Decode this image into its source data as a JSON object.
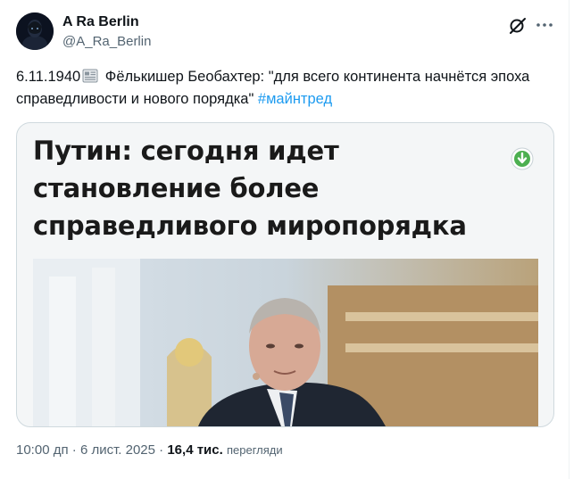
{
  "author": {
    "name": "A Ra Berlin",
    "handle": "@A_Ra_Berlin"
  },
  "tweet": {
    "date_prefix": "6.11.1940",
    "emoji": "newspaper-icon",
    "text": "Фёлькишер Беобахтер: \"для всего континента начнётся эпоха справедливости и нового порядка\"",
    "hashtag": "#майнтред"
  },
  "card": {
    "headline": "Путин: сегодня идет становление более справедливого миропорядка"
  },
  "meta": {
    "time": "10:00 дп",
    "separator": " · ",
    "date": "6 лист. 2025",
    "views_count": "16,4 тис.",
    "views_label": "перегляди"
  },
  "colors": {
    "link": "#1d9bf0",
    "secondary_text": "#536471",
    "download_badge": "#4caf50"
  }
}
